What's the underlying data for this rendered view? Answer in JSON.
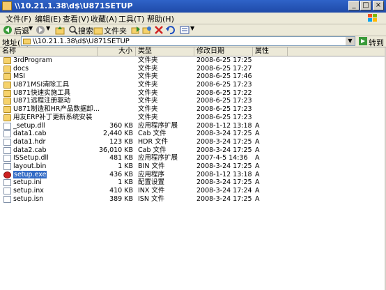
{
  "window": {
    "title": "\\\\10.21.1.38\\d$\\U871SETUP"
  },
  "menu": [
    "文件(F)",
    "编辑(E)",
    "查看(V)",
    "收藏(A)",
    "工具(T)",
    "帮助(H)"
  ],
  "toolbar": {
    "back": "后退",
    "search": "搜索",
    "folders": "文件夹"
  },
  "address": {
    "label": "地址(D)",
    "value": "\\\\10.21.1.38\\d$\\U871SETUP",
    "go": "转到"
  },
  "columns": {
    "name": "名称",
    "size": "大小",
    "type": "类型",
    "modified": "修改日期",
    "attr": "属性"
  },
  "files": [
    {
      "name": "3rdProgram",
      "size": "",
      "type": "文件夹",
      "modified": "2008-6-25 17:25",
      "attr": "",
      "kind": "folder"
    },
    {
      "name": "docs",
      "size": "",
      "type": "文件夹",
      "modified": "2008-6-25 17:27",
      "attr": "",
      "kind": "folder"
    },
    {
      "name": "MSI",
      "size": "",
      "type": "文件夹",
      "modified": "2008-6-25 17:46",
      "attr": "",
      "kind": "folder"
    },
    {
      "name": "U871MSI清除工具",
      "size": "",
      "type": "文件夹",
      "modified": "2008-6-25 17:23",
      "attr": "",
      "kind": "folder"
    },
    {
      "name": "U871快速实施工具",
      "size": "",
      "type": "文件夹",
      "modified": "2008-6-25 17:22",
      "attr": "",
      "kind": "folder"
    },
    {
      "name": "U871远程注册驱动",
      "size": "",
      "type": "文件夹",
      "modified": "2008-6-25 17:23",
      "attr": "",
      "kind": "folder"
    },
    {
      "name": "U871制造和HR产品数据卸...",
      "size": "",
      "type": "文件夹",
      "modified": "2008-6-25 17:23",
      "attr": "",
      "kind": "folder"
    },
    {
      "name": "用友ERP补丁更新系统安装",
      "size": "",
      "type": "文件夹",
      "modified": "2008-6-25 17:23",
      "attr": "",
      "kind": "folder"
    },
    {
      "name": "_setup.dll",
      "size": "360 KB",
      "type": "应用程序扩展",
      "modified": "2008-1-12 13:18",
      "attr": "A",
      "kind": "file"
    },
    {
      "name": "data1.cab",
      "size": "2,440 KB",
      "type": "Cab 文件",
      "modified": "2008-3-24 17:25",
      "attr": "A",
      "kind": "file"
    },
    {
      "name": "data1.hdr",
      "size": "123 KB",
      "type": "HDR 文件",
      "modified": "2008-3-24 17:25",
      "attr": "A",
      "kind": "file"
    },
    {
      "name": "data2.cab",
      "size": "36,010 KB",
      "type": "Cab 文件",
      "modified": "2008-3-24 17:25",
      "attr": "A",
      "kind": "file"
    },
    {
      "name": "ISSetup.dll",
      "size": "481 KB",
      "type": "应用程序扩展",
      "modified": "2007-4-5 14:36",
      "attr": "A",
      "kind": "file"
    },
    {
      "name": "layout.bin",
      "size": "1 KB",
      "type": "BIN 文件",
      "modified": "2008-3-24 17:25",
      "attr": "A",
      "kind": "file"
    },
    {
      "name": "setup.exe",
      "size": "436 KB",
      "type": "应用程序",
      "modified": "2008-1-12 13:18",
      "attr": "A",
      "kind": "exe",
      "selected": true
    },
    {
      "name": "setup.ini",
      "size": "1 KB",
      "type": "配置设置",
      "modified": "2008-3-24 17:25",
      "attr": "A",
      "kind": "file"
    },
    {
      "name": "setup.inx",
      "size": "410 KB",
      "type": "INX 文件",
      "modified": "2008-3-24 17:24",
      "attr": "A",
      "kind": "file"
    },
    {
      "name": "setup.isn",
      "size": "389 KB",
      "type": "ISN 文件",
      "modified": "2008-3-24 17:25",
      "attr": "A",
      "kind": "file"
    }
  ]
}
